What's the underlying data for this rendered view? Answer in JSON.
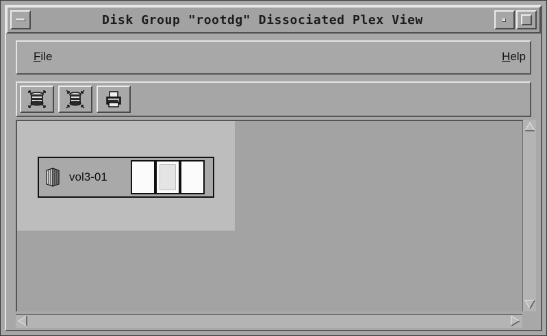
{
  "window": {
    "title": "Disk Group \"rootdg\" Dissociated Plex View"
  },
  "menubar": {
    "file": {
      "mnemonic": "F",
      "rest": "ile"
    },
    "help": {
      "mnemonic": "H",
      "rest": "elp"
    }
  },
  "toolbar": {
    "buttons": [
      {
        "icon": "disk-expand-icon"
      },
      {
        "icon": "disk-collapse-icon"
      },
      {
        "icon": "printer-icon"
      }
    ]
  },
  "canvas": {
    "plex": {
      "label": "vol3-01",
      "subdisks": 3
    }
  },
  "colors": {
    "window_bg": "#a8a8a8",
    "plex_area_bg": "#bdbdbd",
    "canvas_bg": "#a3a3a3"
  }
}
